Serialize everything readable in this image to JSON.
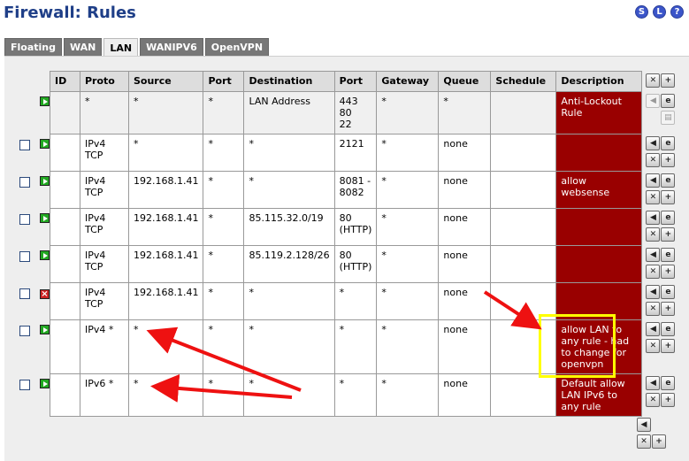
{
  "page": {
    "title": "Firewall: Rules"
  },
  "top_icons": [
    {
      "label": "S",
      "icon": "status-icon"
    },
    {
      "label": "L",
      "icon": "log-icon"
    },
    {
      "label": "?",
      "icon": "help-icon"
    }
  ],
  "tabs": [
    {
      "label": "Floating",
      "active": false
    },
    {
      "label": "WAN",
      "active": false
    },
    {
      "label": "LAN",
      "active": true
    },
    {
      "label": "WANIPV6",
      "active": false
    },
    {
      "label": "OpenVPN",
      "active": false
    }
  ],
  "table": {
    "headers": [
      "ID",
      "Proto",
      "Source",
      "Port",
      "Destination",
      "Port",
      "Gateway",
      "Queue",
      "Schedule",
      "Description"
    ],
    "rows": [
      {
        "checkbox": false,
        "status": "pass",
        "id": "",
        "proto": "*",
        "source": "*",
        "src_port": "*",
        "destination": "LAN Address",
        "dst_port": "443\n80\n22",
        "gateway": "*",
        "queue": "*",
        "schedule": "",
        "description": "Anti-Lockout Rule",
        "locked": true
      },
      {
        "checkbox": true,
        "status": "pass",
        "id": "",
        "proto": "IPv4\nTCP",
        "source": "*",
        "src_port": "*",
        "destination": "*",
        "dst_port": "2121",
        "gateway": "*",
        "queue": "none",
        "schedule": "",
        "description": ""
      },
      {
        "checkbox": true,
        "status": "pass",
        "id": "",
        "proto": "IPv4\nTCP",
        "source": "192.168.1.41",
        "src_port": "*",
        "destination": "*",
        "dst_port": "8081 -\n8082",
        "gateway": "*",
        "queue": "none",
        "schedule": "",
        "description": "allow\nwebsense"
      },
      {
        "checkbox": true,
        "status": "pass",
        "id": "",
        "proto": "IPv4\nTCP",
        "source": "192.168.1.41",
        "src_port": "*",
        "destination": "85.115.32.0/19",
        "dst_port": "80\n(HTTP)",
        "gateway": "*",
        "queue": "none",
        "schedule": "",
        "description": ""
      },
      {
        "checkbox": true,
        "status": "pass",
        "id": "",
        "proto": "IPv4\nTCP",
        "source": "192.168.1.41",
        "src_port": "*",
        "destination": "85.119.2.128/26",
        "dst_port": "80\n(HTTP)",
        "gateway": "*",
        "queue": "none",
        "schedule": "",
        "description": ""
      },
      {
        "checkbox": true,
        "status": "block",
        "id": "",
        "proto": "IPv4\nTCP",
        "source": "192.168.1.41",
        "src_port": "*",
        "destination": "*",
        "dst_port": "*",
        "gateway": "*",
        "queue": "none",
        "schedule": "",
        "description": ""
      },
      {
        "checkbox": true,
        "status": "pass",
        "id": "",
        "proto": "IPv4 *",
        "source": "*",
        "src_port": "*",
        "destination": "*",
        "dst_port": "*",
        "gateway": "*",
        "queue": "none",
        "schedule": "",
        "description": "allow LAN to any rule - had to change for openvpn"
      },
      {
        "checkbox": true,
        "status": "pass",
        "id": "",
        "proto": "IPv6 *",
        "source": "*",
        "src_port": "*",
        "destination": "*",
        "dst_port": "*",
        "gateway": "*",
        "queue": "none",
        "schedule": "",
        "description": "Default allow LAN IPv6 to any rule"
      }
    ]
  },
  "action_icons": {
    "move": "move-icon",
    "add": "add-icon",
    "edit": "edit-icon",
    "delete": "delete-icon",
    "copy": "copy-icon"
  },
  "colors": {
    "title": "#1f3f88",
    "description_bg": "#990000",
    "highlight": "#ffff00",
    "arrow": "#ee1111",
    "tab_bg": "#777777",
    "pass": "#22a822",
    "block": "#cc2222"
  }
}
